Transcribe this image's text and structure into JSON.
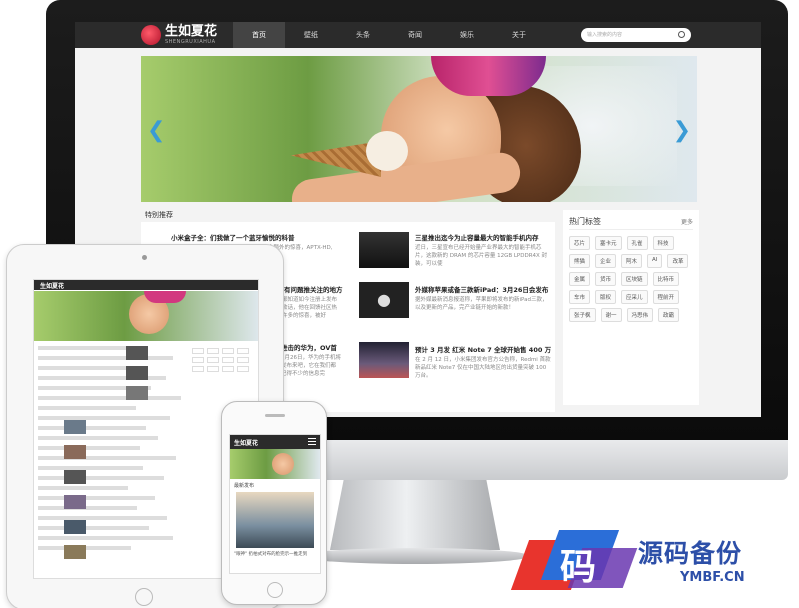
{
  "site": {
    "logo_text": "生如夏花",
    "logo_sub": "SHENGRUXIAHUA",
    "nav": [
      "首页",
      "壁纸",
      "头条",
      "奇闻",
      "娱乐",
      "关于"
    ],
    "search_placeholder": "输入搜索的内容"
  },
  "section_title": "特别推荐",
  "articles": [
    {
      "title": "小米盒子全：们我做了一个蓝牙愉悦的科普",
      "desc": "在小米发布会上，小米盒子4的发布是一个额外的惊喜，APTX-HD,",
      "thumb": "dark-chip"
    },
    {
      "title": "三星推出迄今为止容量最大的智能手机内存",
      "desc": "近日，三星宣布已经开始量产业界最大的智能手机芯片，这款新的 DRAM 的芯片容量 12GB LPDDR4X 封装，可以使",
      "thumb": "chip"
    },
    {
      "title": "注册有问题推关注的地方",
      "desc": "大家都知道如今注册上发布了一款话，他在回馈社区热线有许多的惊喜，被好",
      "thumb": "dark"
    },
    {
      "title": "外媒称苹果或备三款新iPad：3月26日会发布",
      "desc": "据外媒最新消息报道称，苹果即将发布的新iPad三款，以及更新的产品，完产业链开始的新款！",
      "thumb": "apple"
    },
    {
      "title": "进击的华为，OV首",
      "desc": "3月26日，华为的手机将发布来吧，它在我们都记得不少的信息完",
      "thumb": "dark"
    },
    {
      "title": "预计 3 月发 红米 Note 7 全球开始售 400 万",
      "desc": "在 2 月 12 日，小米集团发布官方公告称，Redmi 首款新品红米 Note7 仅在中国大陆地区的出货量突破 100 万台。",
      "thumb": "stage"
    }
  ],
  "hot_tags": {
    "title": "热门标签",
    "more": "更多",
    "tags": [
      "芯片",
      "塞卡元",
      "孔雀",
      "科技",
      "熊猫",
      "企业",
      "阿木",
      "AI",
      "改革",
      "金属",
      "货币",
      "区块链",
      "比特币",
      "车市",
      "版权",
      "应采儿",
      "程前开",
      "张子枫",
      "谢一",
      "冯思伟",
      "政霸"
    ]
  },
  "ipad": {
    "logo_text": "生如夏花"
  },
  "iphone": {
    "logo_text": "生如夏花",
    "label": "最新发布",
    "caption": "\"眼神\" 扔柏式对布的脸完示一推走到"
  },
  "watermark": {
    "glyph": "码",
    "title": "源码备份",
    "url": "YMBF.CN"
  },
  "colors": {
    "nav_bg": "#2b2b2b",
    "accent": "#3a9bd5",
    "watermark_blue": "#2d4fa8",
    "watermark_red": "#e8342d"
  }
}
